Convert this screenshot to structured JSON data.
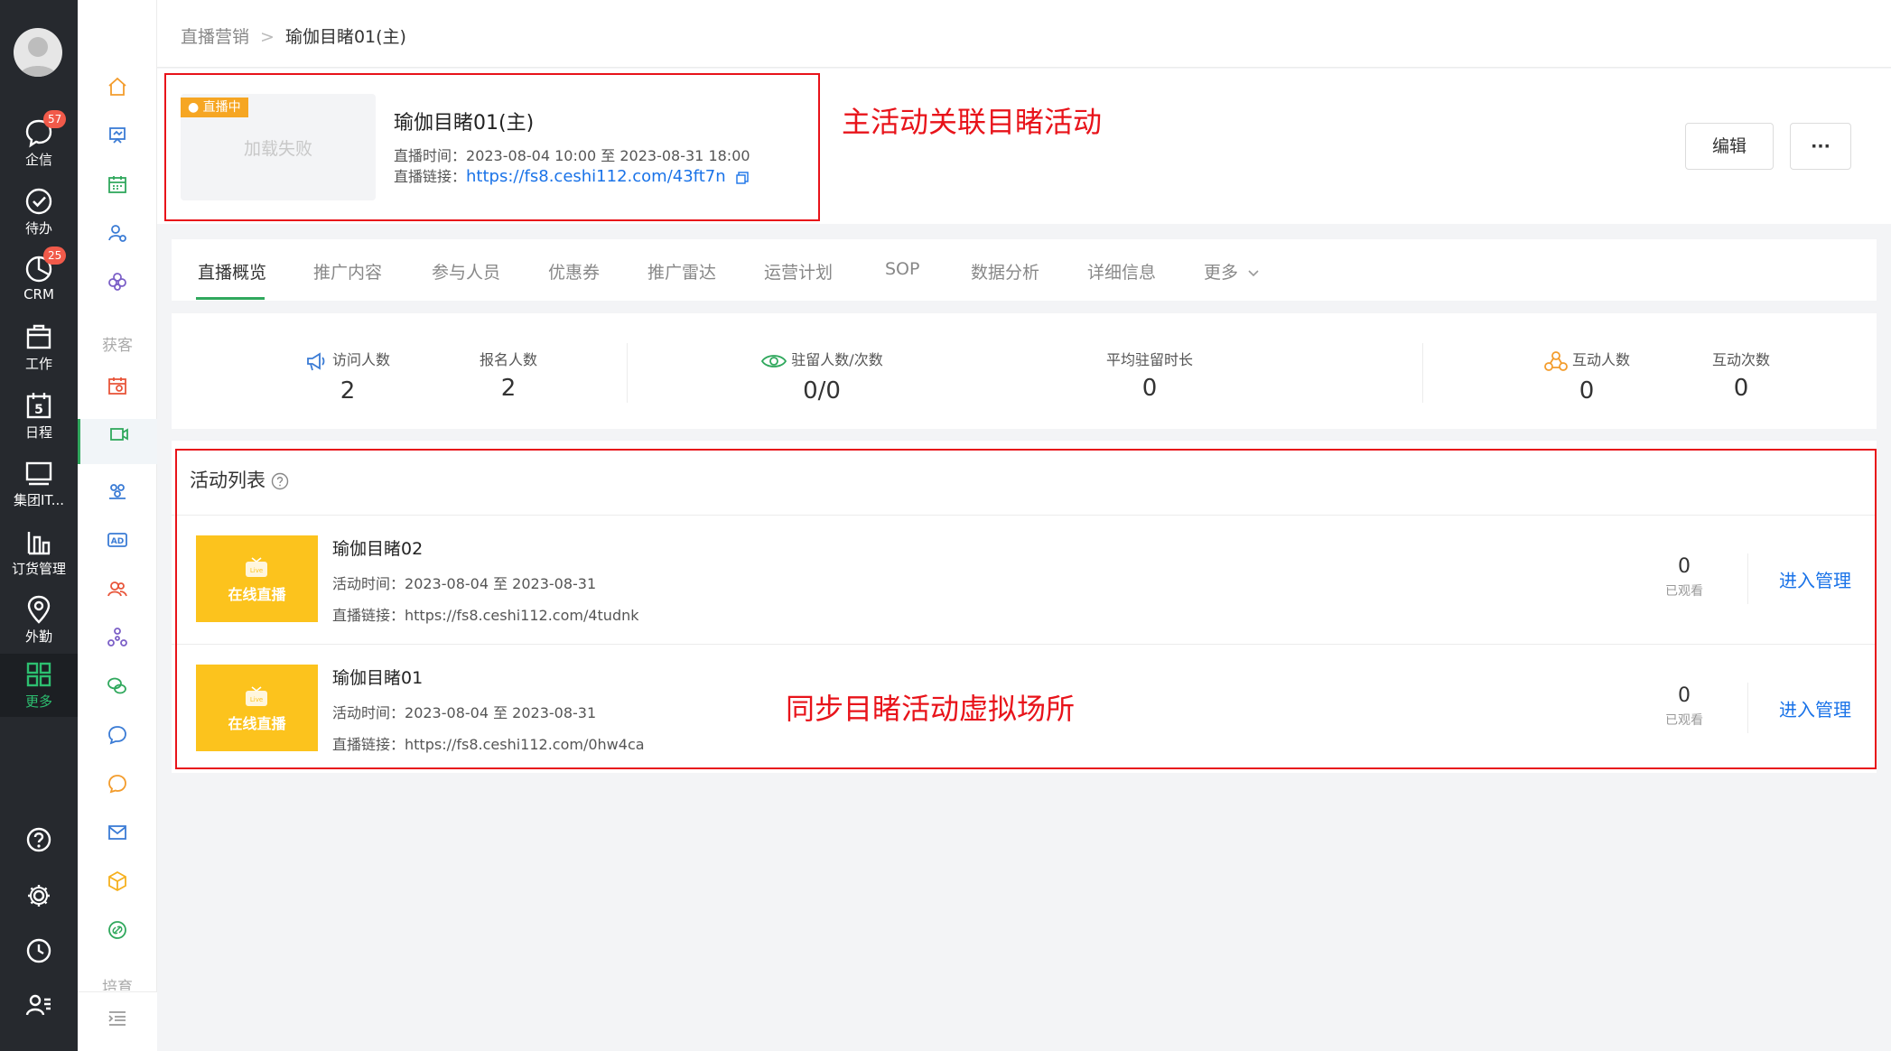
{
  "nav": {
    "items": [
      {
        "label": "企信",
        "badge": "57"
      },
      {
        "label": "待办"
      },
      {
        "label": "CRM",
        "badge": "25"
      },
      {
        "label": "工作"
      },
      {
        "label": "日程"
      },
      {
        "label": "集团IT..."
      },
      {
        "label": "订货管理"
      },
      {
        "label": "外勤"
      },
      {
        "label": "更多"
      }
    ],
    "calendar_day": "5"
  },
  "subnav": {
    "section_acquire": "获客",
    "section_train": "培育"
  },
  "breadcrumb": {
    "parent": "直播营销",
    "separator": ">",
    "current": "瑜伽目睹01(主)"
  },
  "header": {
    "status_tag": "直播中",
    "thumb_fail_text": "加载失败",
    "title": "瑜伽目睹01(主)",
    "time_label": "直播时间：",
    "time_value": "2023-08-04 10:00 至 2023-08-31 18:00",
    "link_label": "直播链接：",
    "link_value": "https://fs8.ceshi112.com/43ft7n",
    "edit_button": "编辑",
    "more_button": "···"
  },
  "annotations": {
    "main_activity": "主活动关联目睹活动",
    "sync_venue": "同步目睹活动虚拟场所"
  },
  "tabs": [
    "直播概览",
    "推广内容",
    "参与人员",
    "优惠券",
    "推广雷达",
    "运营计划",
    "SOP",
    "数据分析",
    "详细信息",
    "更多"
  ],
  "stats": [
    {
      "label": "访问人数",
      "value": "2"
    },
    {
      "label": "报名人数",
      "value": "2"
    },
    {
      "label": "驻留人数/次数",
      "value": "0/0"
    },
    {
      "label": "平均驻留时长",
      "value": "0"
    },
    {
      "label": "互动人数",
      "value": "0"
    },
    {
      "label": "互动次数",
      "value": "0"
    }
  ],
  "activity_list": {
    "title": "活动列表",
    "rows": [
      {
        "cover_text": "在线直播",
        "title": "瑜伽目睹02",
        "time_label": "活动时间：",
        "time_value": "2023-08-04 至 2023-08-31",
        "link_label": "直播链接：",
        "link_value": "https://fs8.ceshi112.com/4tudnk",
        "count": "0",
        "count_label": "已观看",
        "manage": "进入管理"
      },
      {
        "cover_text": "在线直播",
        "title": "瑜伽目睹01",
        "time_label": "活动时间：",
        "time_value": "2023-08-04 至 2023-08-31",
        "link_label": "直播链接：",
        "link_value": "https://fs8.ceshi112.com/0hw4ca",
        "count": "0",
        "count_label": "已观看",
        "manage": "进入管理"
      }
    ]
  },
  "colors": {
    "accent_green": "#30a85d",
    "link_blue": "#1a73e8",
    "live_orange": "#f6a623",
    "cover_yellow": "#fcc31d",
    "annotation_red": "#e8131a",
    "nav_dark": "#26292e"
  }
}
